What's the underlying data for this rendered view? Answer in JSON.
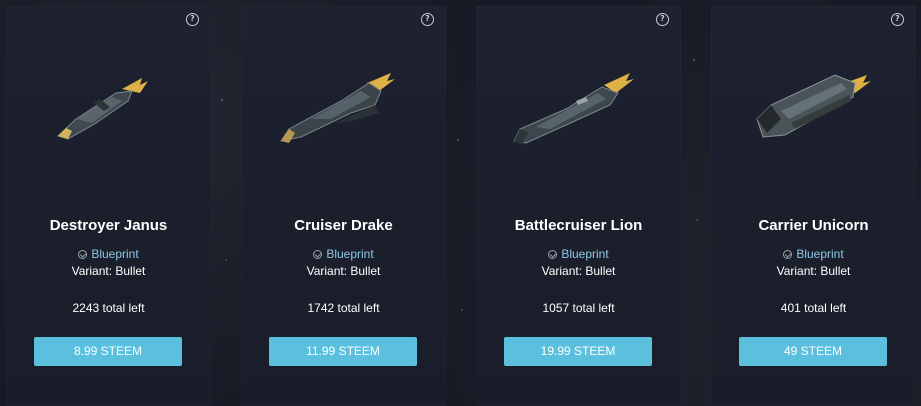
{
  "cards": [
    {
      "name": "Destroyer Janus",
      "tag": "Blueprint",
      "variant": "Variant: Bullet",
      "left": "2243 total left",
      "price": "8.99 STEEM",
      "icon": "destroyer-ship-image"
    },
    {
      "name": "Cruiser Drake",
      "tag": "Blueprint",
      "variant": "Variant: Bullet",
      "left": "1742 total left",
      "price": "11.99 STEEM",
      "icon": "cruiser-ship-image"
    },
    {
      "name": "Battlecruiser Lion",
      "tag": "Blueprint",
      "variant": "Variant: Bullet",
      "left": "1057 total left",
      "price": "19.99 STEEM",
      "icon": "battlecruiser-ship-image"
    },
    {
      "name": "Carrier Unicorn",
      "tag": "Blueprint",
      "variant": "Variant: Bullet",
      "left": "401 total left",
      "price": "49 STEEM",
      "icon": "carrier-ship-image"
    }
  ],
  "colors": {
    "background": "#161a24",
    "card": "#1d2130",
    "button": "#5bc0de",
    "tag": "#8ec8e6"
  }
}
